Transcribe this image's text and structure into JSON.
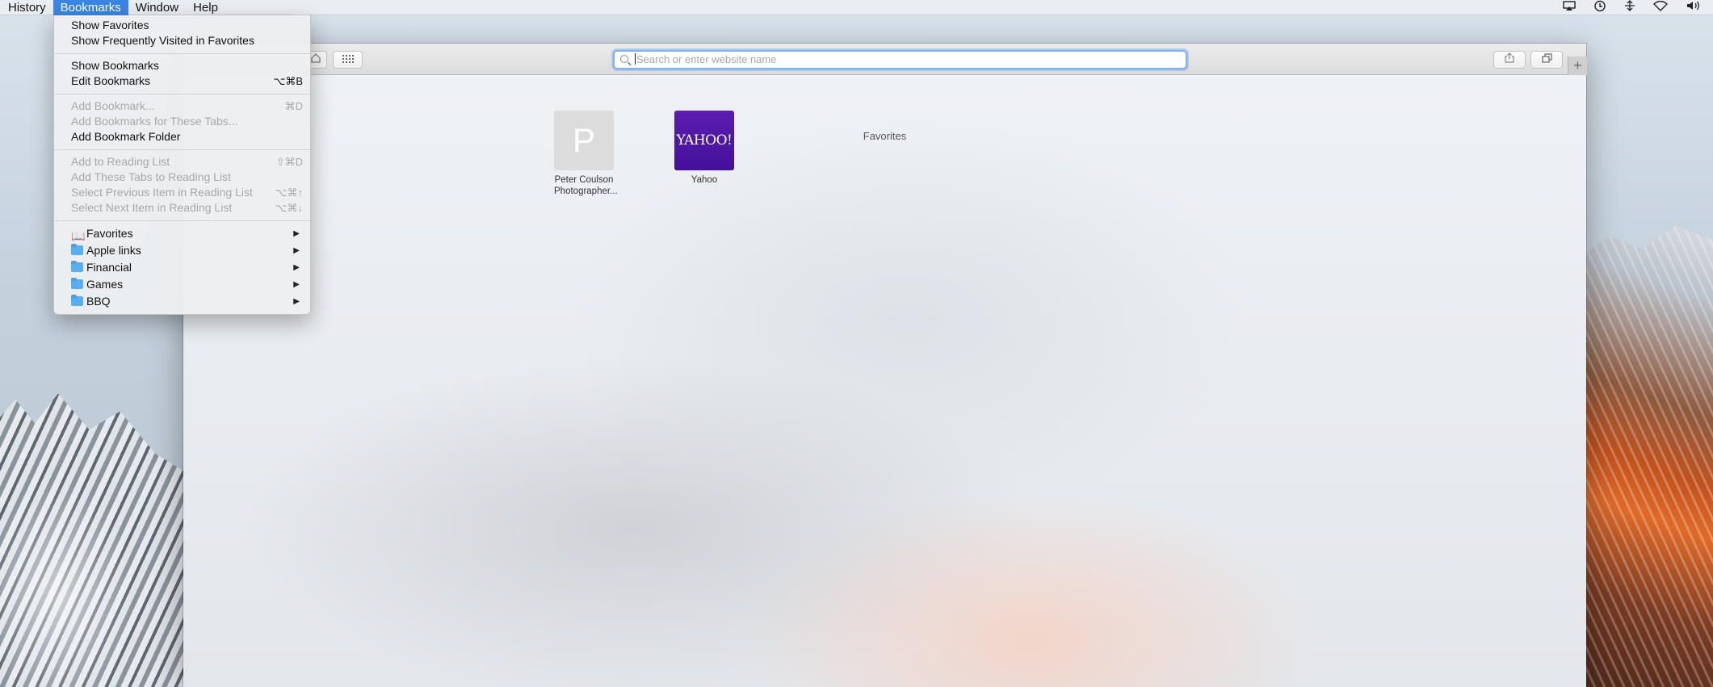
{
  "menubar": {
    "items": [
      "History",
      "Bookmarks",
      "Window",
      "Help"
    ],
    "active": "Bookmarks"
  },
  "status_icons": [
    "airplay-icon",
    "time-machine-icon",
    "network-arrows-icon",
    "wifi-icon",
    "volume-icon"
  ],
  "safari": {
    "address_placeholder": "Search or enter website name",
    "new_tab": "+",
    "favorites_title": "Favorites",
    "favorites": [
      {
        "letter": "P",
        "label_line1": "Peter Coulson",
        "label_line2": "Photographer..."
      },
      {
        "logo_text": "YAHOO!",
        "label": "Yahoo"
      }
    ]
  },
  "bookmarks_menu": {
    "items": [
      {
        "label": "Show Favorites",
        "shortcut": "",
        "enabled": true
      },
      {
        "label": "Show Frequently Visited in Favorites",
        "shortcut": "",
        "enabled": true
      },
      {
        "label": "Show Bookmarks",
        "shortcut": "",
        "enabled": true
      },
      {
        "label": "Edit Bookmarks",
        "shortcut": "⌥⌘B",
        "enabled": true
      },
      {
        "label": "Add Bookmark...",
        "shortcut": "⌘D",
        "enabled": false
      },
      {
        "label": "Add Bookmarks for These Tabs...",
        "shortcut": "",
        "enabled": false
      },
      {
        "label": "Add Bookmark Folder",
        "shortcut": "",
        "enabled": true
      },
      {
        "label": "Add to Reading List",
        "shortcut": "⇧⌘D",
        "enabled": false
      },
      {
        "label": "Add These Tabs to Reading List",
        "shortcut": "",
        "enabled": false
      },
      {
        "label": "Select Previous Item in Reading List",
        "shortcut": "⌥⌘↑",
        "enabled": false
      },
      {
        "label": "Select Next Item in Reading List",
        "shortcut": "⌥⌘↓",
        "enabled": false
      }
    ],
    "submenus": [
      {
        "label": "Favorites",
        "icon": "book-icon"
      },
      {
        "label": "Apple links",
        "icon": "folder-icon"
      },
      {
        "label": "Financial",
        "icon": "folder-icon"
      },
      {
        "label": "Games",
        "icon": "folder-icon"
      },
      {
        "label": "BBQ",
        "icon": "folder-icon"
      }
    ]
  },
  "colors": {
    "menu_highlight": "#3a86e5",
    "yahoo_purple": "#5b1eb0",
    "folder_blue": "#5aaef0",
    "address_focus": "#7fb0ee"
  }
}
